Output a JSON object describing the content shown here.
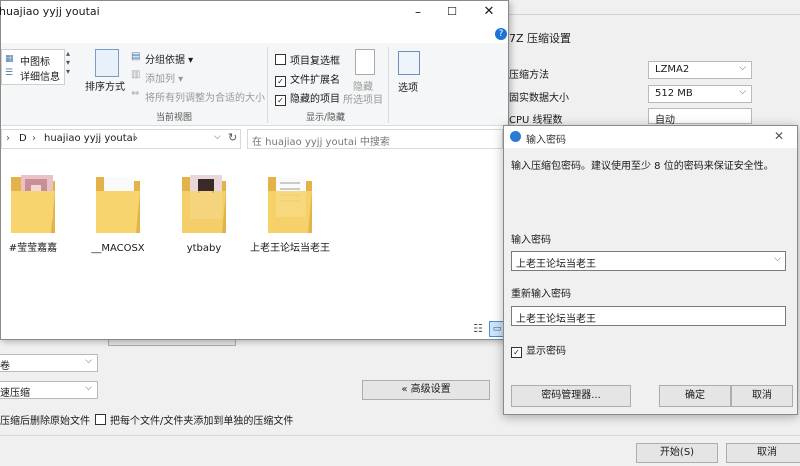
{
  "archive_dialog": {
    "title": "7Z 压缩设置",
    "method_label": "压缩方法",
    "method_value": "LZMA2",
    "dict_label": "固实数据大小",
    "dict_value": "512 MB",
    "threads_label": "CPU 线程数",
    "threads_value": "自动",
    "volume_value": "卷",
    "speed_value": "速压缩",
    "delete_after_label": "压缩后删除原始文件",
    "separate_label": "把每个文件/文件夹添加到单独的压缩文件",
    "advanced_button": "« 高级设置",
    "start_button": "开始(S)",
    "cancel_button": "取消"
  },
  "explorer": {
    "title": "huajiao yyjj youtai",
    "ribbon": {
      "medium_icons": "中图标",
      "details": "详细信息",
      "sort_by": "排序方式",
      "group_by": "分组依据 ▾",
      "add_column": "添加列 ▾",
      "fit_columns": "将所有列调整为合适的大小",
      "current_view": "当前视图",
      "item_checkboxes": "项目复选框",
      "file_extensions": "文件扩展名",
      "hidden_items": "隐藏的项目",
      "hide": "隐藏",
      "hide_selected": "所选项目",
      "options": "选项",
      "show_hide": "显示/隐藏"
    },
    "address": {
      "drive": "D",
      "folder": "huajiao yyjj youtai",
      "search_placeholder": "在 huajiao yyjj youtai 中搜索"
    },
    "items": [
      {
        "name": "#莹莹嘉嘉"
      },
      {
        "name": "__MACOSX"
      },
      {
        "name": "ytbaby"
      },
      {
        "name": "上老王论坛当老王"
      }
    ]
  },
  "password_dialog": {
    "title": "输入密码",
    "description": "输入压缩包密码。建议使用至少 8 位的密码来保证安全性。",
    "password_label": "输入密码",
    "password_value": "上老王论坛当老王",
    "reenter_label": "重新输入密码",
    "reenter_value": "上老王论坛当老王",
    "show_password_label": "显示密码",
    "manager_button": "密码管理器...",
    "ok_button": "确定",
    "cancel_button": "取消"
  }
}
